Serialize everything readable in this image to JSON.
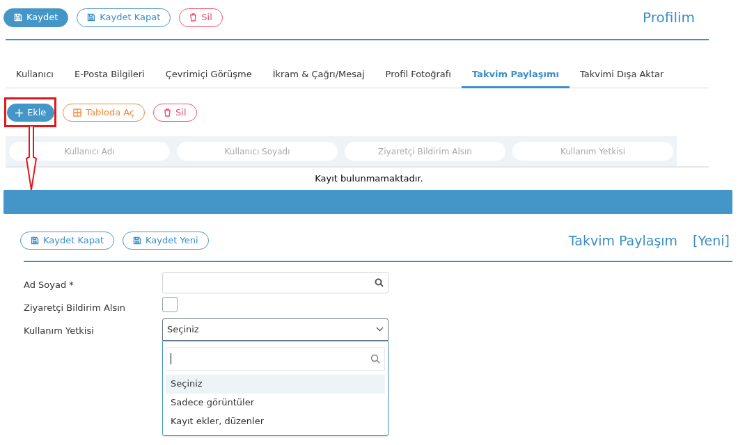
{
  "toolbar": {
    "buttons": [
      {
        "kind": "primary",
        "label": "Kaydet"
      },
      {
        "kind": "outline",
        "label": "Kaydet Kapat"
      },
      {
        "kind": "danger",
        "label": "Sil"
      }
    ]
  },
  "page_title": "Profilim",
  "tabs": [
    {
      "label": "Kullanıcı",
      "selected": false
    },
    {
      "label": "E-Posta Bilgileri",
      "selected": false
    },
    {
      "label": "Çevrimiçi Görüşme",
      "selected": false
    },
    {
      "label": "İkram & Çağrı/Mesaj",
      "selected": false
    },
    {
      "label": "Profil Fotoğrafı",
      "selected": false
    },
    {
      "label": "Takvim Paylaşımı",
      "selected": true
    },
    {
      "label": "Takvimi Dışa Aktar",
      "selected": false
    }
  ],
  "grid_toolbar": {
    "buttons": [
      {
        "kind": "add",
        "label": "Ekle",
        "highlighted": true
      },
      {
        "kind": "table",
        "label": "Tabloda Aç",
        "highlighted": false
      },
      {
        "kind": "danger",
        "label": "Sil",
        "highlighted": false
      }
    ]
  },
  "table": {
    "columns": [
      "Kullanıcı Adı",
      "Kullanıcı Soyadı",
      "Ziyaretçi Bildirim Alsın",
      "Kullanım Yetkisi"
    ],
    "empty_message": "Kayıt bulunmamaktadır."
  },
  "form": {
    "buttons": [
      {
        "kind": "outline",
        "label": "Kaydet Kapat"
      },
      {
        "kind": "outline",
        "label": "Kaydet Yeni"
      }
    ],
    "title": "Takvim Paylaşım",
    "title_badge": "[Yeni]",
    "fields": [
      {
        "kind": "search",
        "label": "Ad Soyad *"
      },
      {
        "kind": "checkbox",
        "label": "Ziyaretçi Bildirim Alsın",
        "checked": false
      },
      {
        "kind": "select",
        "label": "Kullanım Yetkisi",
        "value": "Seçiniz",
        "expanded": true,
        "options": [
          {
            "label": "Seçiniz",
            "selected": true
          },
          {
            "label": "Sadece görüntüler",
            "selected": false
          },
          {
            "label": "Kayıt ekler, düzenler",
            "selected": false
          }
        ]
      }
    ]
  }
}
